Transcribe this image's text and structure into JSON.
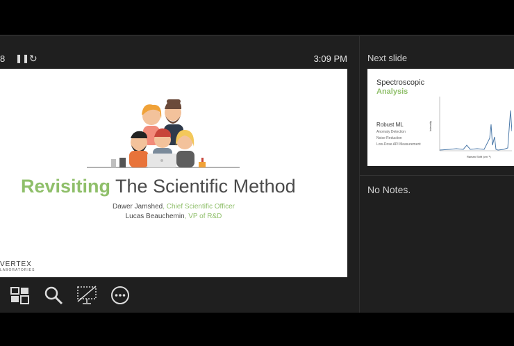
{
  "presenter": {
    "timer_fragment": "8",
    "pause_icon": "pause-icon",
    "restart_icon": "restart-icon",
    "clock": "3:09 PM",
    "next_slide_label": "Next slide",
    "notes": "No Notes."
  },
  "current_slide": {
    "title_accent": "Revisiting",
    "title_rest": " The Scientific Method",
    "authors": [
      {
        "name": "Dawer Jamshed",
        "role": ", Chief Scientific Officer"
      },
      {
        "name": "Lucas Beauchemin",
        "role": ", VP of R&D"
      }
    ],
    "logo": "VERTEX",
    "logo_sub": "LABORATORIES"
  },
  "next_slide": {
    "title_line1": "Spectroscopic",
    "title_line2": "Analysis",
    "heading": "Robust ML",
    "bullets": [
      "Anomaly Detection",
      "Noise Reduction",
      "Low-Dose API Measurement"
    ],
    "ylabel": "Intensity",
    "xlabel": "Raman Shift (cm⁻¹)"
  },
  "tools": [
    {
      "name": "see-all-slides",
      "icon": "slides-grid-icon"
    },
    {
      "name": "zoom",
      "icon": "magnifier-icon"
    },
    {
      "name": "black-screen",
      "icon": "screen-off-icon"
    },
    {
      "name": "more-options",
      "icon": "more-icon"
    }
  ],
  "colors": {
    "accent": "#8fbf6a",
    "bg": "#1f1f1f"
  }
}
